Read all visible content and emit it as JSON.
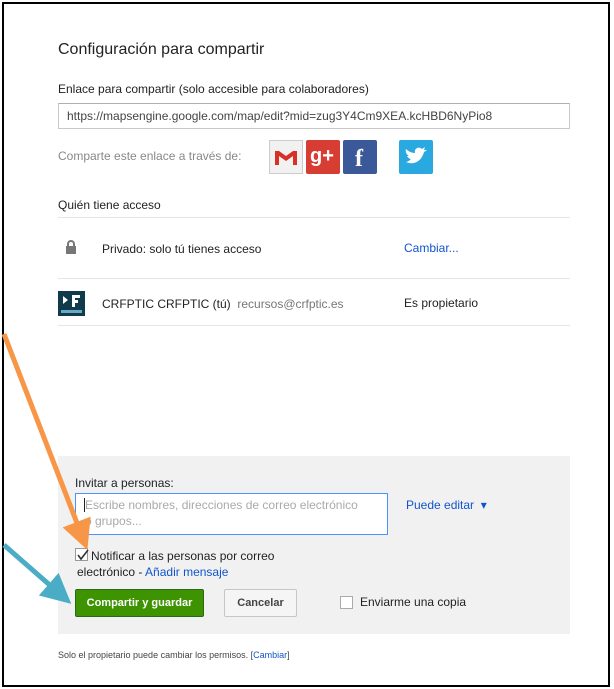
{
  "dialog": {
    "title": "Configuración para compartir",
    "link_label": "Enlace para compartir (solo accesible para colaboradores)",
    "link_value": "https://mapsengine.google.com/map/edit?mid=zug3Y4Cm9XEA.kcHBD6NyPio8",
    "share_via_label": "Comparte este enlace a través de:",
    "social": [
      {
        "name": "Gmail",
        "icon": "gmail-icon",
        "glyph": "M"
      },
      {
        "name": "Google+",
        "icon": "google-plus-icon",
        "glyph": "g+"
      },
      {
        "name": "Facebook",
        "icon": "facebook-icon",
        "glyph": "f"
      },
      {
        "name": "Twitter",
        "icon": "twitter-icon",
        "glyph": "t"
      }
    ],
    "access_label": "Quién tiene acceso",
    "access_rows": [
      {
        "icon": "lock-icon",
        "text": "Privado: solo tú tienes acceso",
        "action": "Cambiar..."
      },
      {
        "icon": "avatar-icon",
        "name": "CRFPTIC CRFPTIC (tú)",
        "email": "recursos@crfptic.es",
        "role": "Es propietario"
      }
    ],
    "invite": {
      "label": "Invitar a personas:",
      "placeholder": "Escribe nombres, direcciones de correo electrónico o grupos...",
      "permission": "Puede editar",
      "notify_text": "Notificar a las personas por correo electrónico",
      "notify_separator": " - ",
      "add_message": "Añadir mensaje",
      "notify_checked": true
    },
    "buttons": {
      "primary": "Compartir y guardar",
      "cancel": "Cancelar"
    },
    "send_copy_label": "Enviarme una copia",
    "footer_text": "Solo el propietario puede cambiar los permisos.",
    "footer_link": "Cambiar"
  },
  "colors": {
    "primary_button": "#3d9400",
    "link": "#1155cc",
    "arrow_orange": "#f79646",
    "arrow_blue": "#4bacc6"
  }
}
